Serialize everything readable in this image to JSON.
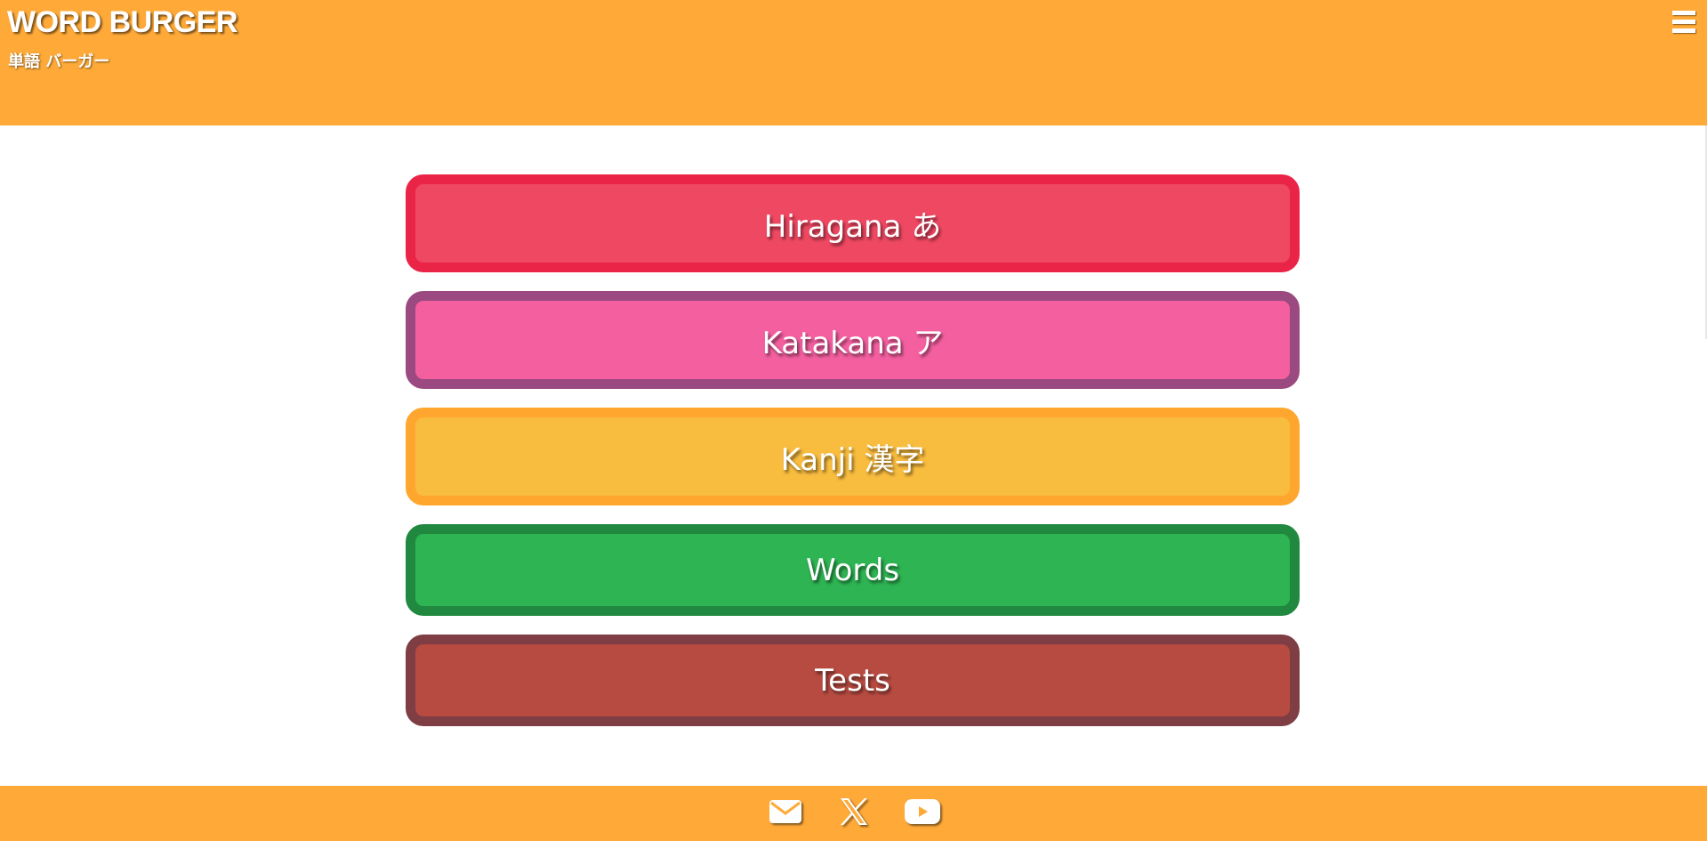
{
  "header": {
    "title": "WORD BURGER",
    "subtitle": "単語 バーガー",
    "menu_icon": "hamburger-menu-icon"
  },
  "menu": {
    "items": [
      {
        "label": "Hiragana あ",
        "border_color": "#EA2447",
        "fill_color": "#EF4862"
      },
      {
        "label": "Katakana ア",
        "border_color": "#9A4A80",
        "fill_color": "#F45FA0"
      },
      {
        "label": "Kanji 漢字",
        "border_color": "#FFA62E",
        "fill_color": "#F8BC3F"
      },
      {
        "label": "Words",
        "border_color": "#21893F",
        "fill_color": "#2EB453"
      },
      {
        "label": "Tests",
        "border_color": "#7E3E44",
        "fill_color": "#B74B41"
      }
    ]
  },
  "footer": {
    "icons": [
      "mail-icon",
      "x-logo-icon",
      "youtube-icon"
    ]
  },
  "colors": {
    "brand": "#FFAA38",
    "text": "#FFFFFF"
  }
}
